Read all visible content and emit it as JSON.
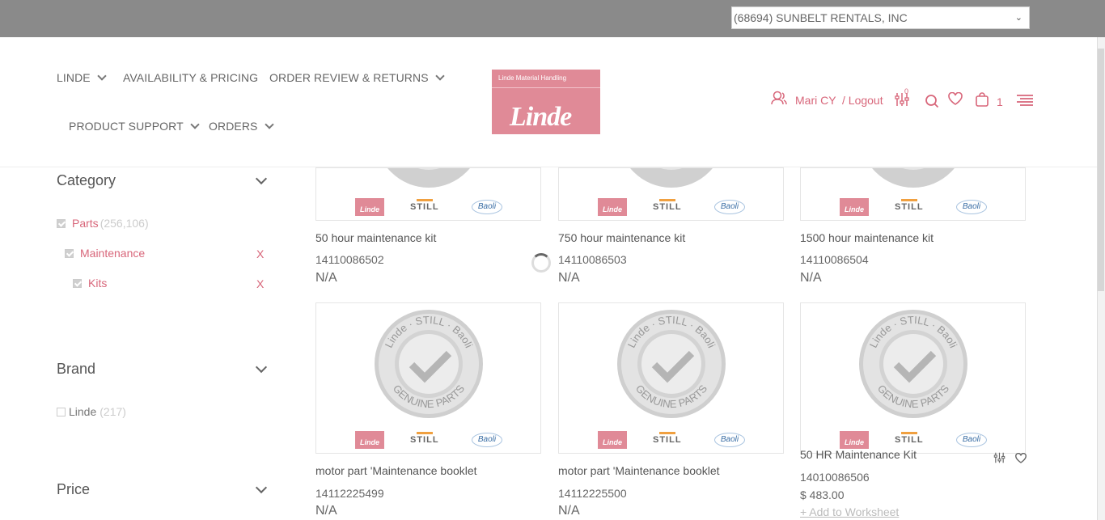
{
  "account_selector": {
    "value": "(68694) SUNBELT RENTALS, INC"
  },
  "nav": {
    "linde": "LINDE",
    "availability": "AVAILABILITY & PRICING",
    "order_review": "ORDER REVIEW & RETURNS",
    "product_support": "PRODUCT SUPPORT",
    "orders": "ORDERS"
  },
  "logo": {
    "tagline": "Linde Material Handling",
    "wordmark": "Linde"
  },
  "user": {
    "name": "Mari CY",
    "logout": "/ Logout",
    "compare_count": "0",
    "cart_count": "1"
  },
  "filters": {
    "category": {
      "title": "Category",
      "items": [
        {
          "label": "Parts",
          "count": "(256,106)"
        },
        {
          "label": "Maintenance",
          "remove": "X"
        },
        {
          "label": "Kits",
          "remove": "X"
        }
      ]
    },
    "brand": {
      "title": "Brand",
      "items": [
        {
          "label": "Linde",
          "count": "(217)"
        }
      ]
    },
    "price": {
      "title": "Price"
    }
  },
  "brands_row": {
    "linde": "Linde",
    "still": "STILL",
    "baoli": "Baoli"
  },
  "seal": {
    "top": "Linde · STILL · Baoli",
    "bottom": "GENUINE PARTS"
  },
  "products": [
    {
      "title": "50 hour maintenance kit",
      "sku": "14110086502",
      "price": "N/A"
    },
    {
      "title": "750 hour maintenance kit",
      "sku": "14110086503",
      "price": "N/A"
    },
    {
      "title": "1500 hour maintenance kit",
      "sku": "14110086504",
      "price": "N/A"
    },
    {
      "title": "motor part 'Maintenance booklet",
      "sku": "14112225499",
      "price": "N/A"
    },
    {
      "title": "motor part 'Maintenance booklet",
      "sku": "14112225500",
      "price": "N/A"
    },
    {
      "title": "50 HR Maintenance Kit",
      "sku": "14010086506",
      "price": "$ 483.00",
      "action": "+ Add to Worksheet"
    }
  ],
  "colors": {
    "accent": "#d8667a",
    "topbar": "#8a8a8a",
    "logo_bg": "#e08a97"
  }
}
